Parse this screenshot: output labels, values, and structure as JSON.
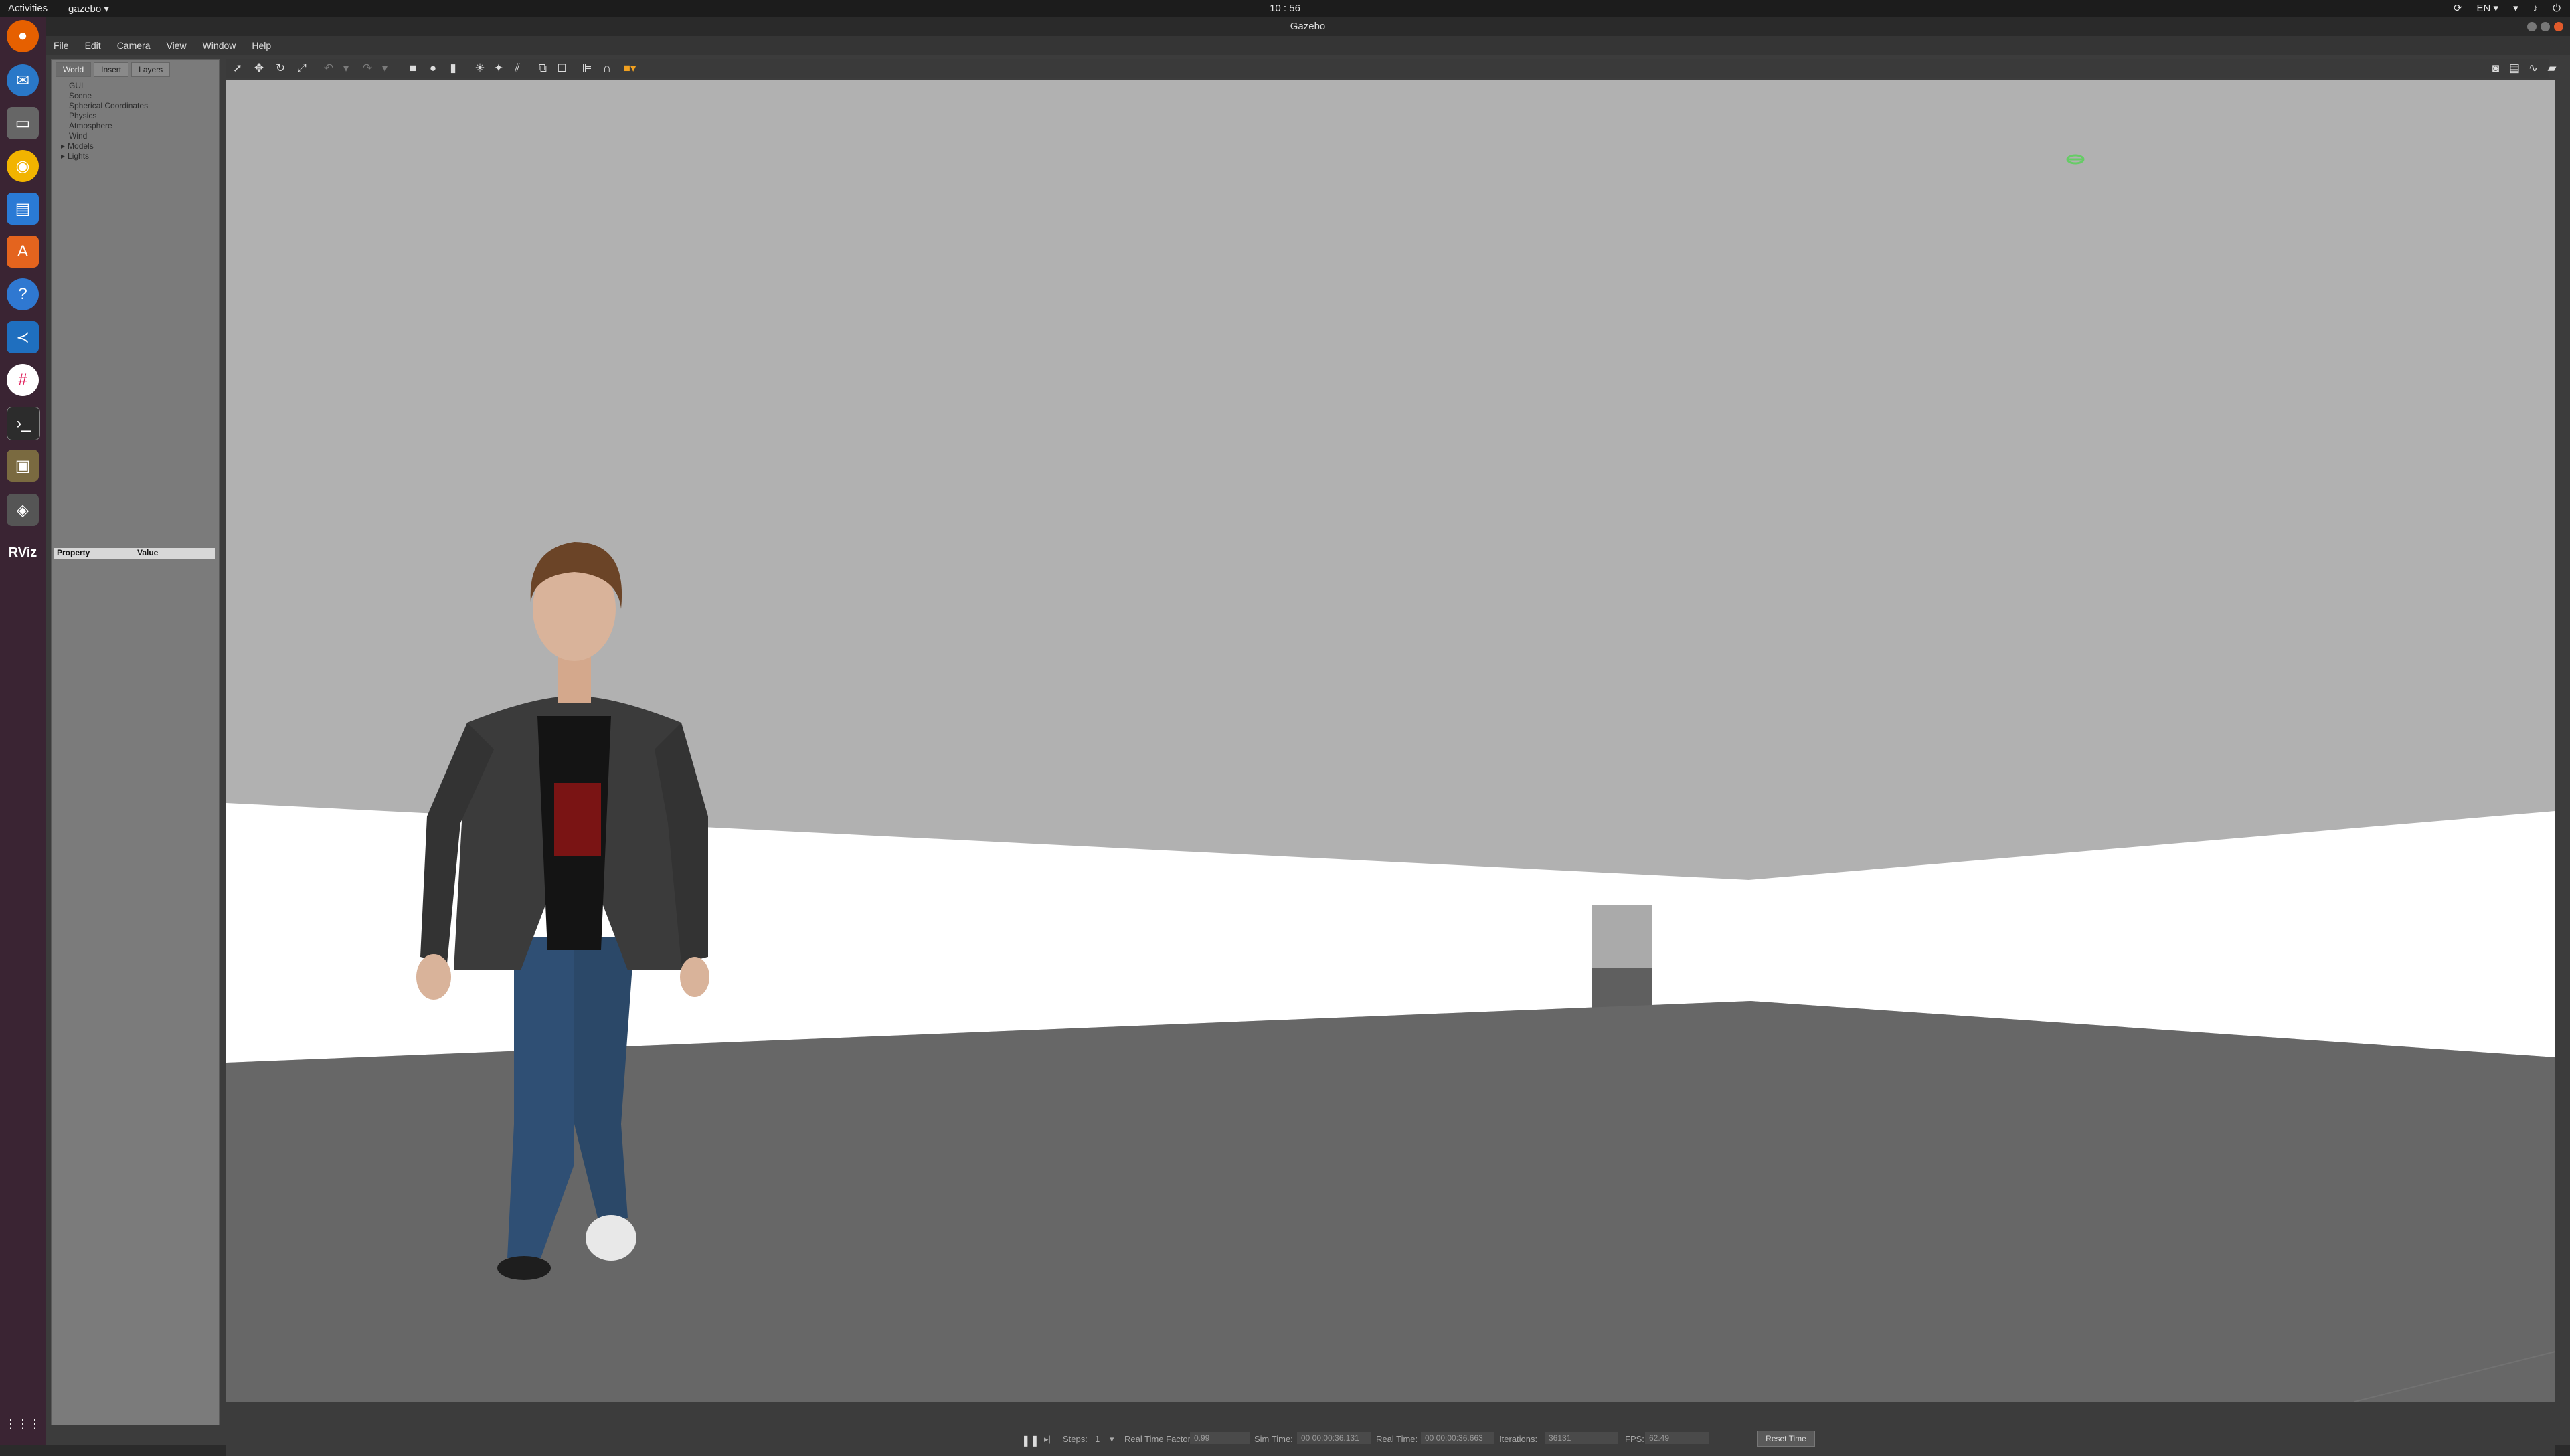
{
  "topbar": {
    "activities": "Activities",
    "app_menu": "gazebo ▾",
    "clock": "10 : 56",
    "lang": "EN ▾"
  },
  "dock": {
    "items": [
      "firefox-icon",
      "thunderbird-icon",
      "files-icon",
      "rhythmbox-icon",
      "writer-icon",
      "software-icon",
      "help-icon",
      "vscode-icon",
      "slack-icon",
      "terminal-icon",
      "image-viewer-icon",
      "gazebo-icon",
      "rviz-icon"
    ],
    "rviz_label": "RViz",
    "apps_grid": "⋮⋮⋮"
  },
  "window": {
    "title": "Gazebo"
  },
  "menu": [
    "File",
    "Edit",
    "Camera",
    "View",
    "Window",
    "Help"
  ],
  "left_panel": {
    "tabs": [
      "World",
      "Insert",
      "Layers"
    ],
    "active_tab": "World",
    "tree": [
      "GUI",
      "Scene",
      "Spherical Coordinates",
      "Physics",
      "Atmosphere",
      "Wind",
      "Models",
      "Lights"
    ],
    "property_header": "Property",
    "value_header": "Value"
  },
  "statusbar": {
    "steps_label": "Steps:",
    "steps_value": "1",
    "rtf_label": "Real Time Factor:",
    "rtf_value": "0.99",
    "sim_time_label": "Sim Time:",
    "sim_time_value": "00 00:00:36.131",
    "real_time_label": "Real Time:",
    "real_time_value": "00 00:00:36.663",
    "iterations_label": "Iterations:",
    "iterations_value": "36131",
    "fps_label": "FPS:",
    "fps_value": "62.49",
    "reset_label": "Reset Time"
  },
  "colors": {
    "sky": "#b1b1b1",
    "wall": "#ffffff",
    "floor": "#676767",
    "dock": "#3a2433"
  }
}
